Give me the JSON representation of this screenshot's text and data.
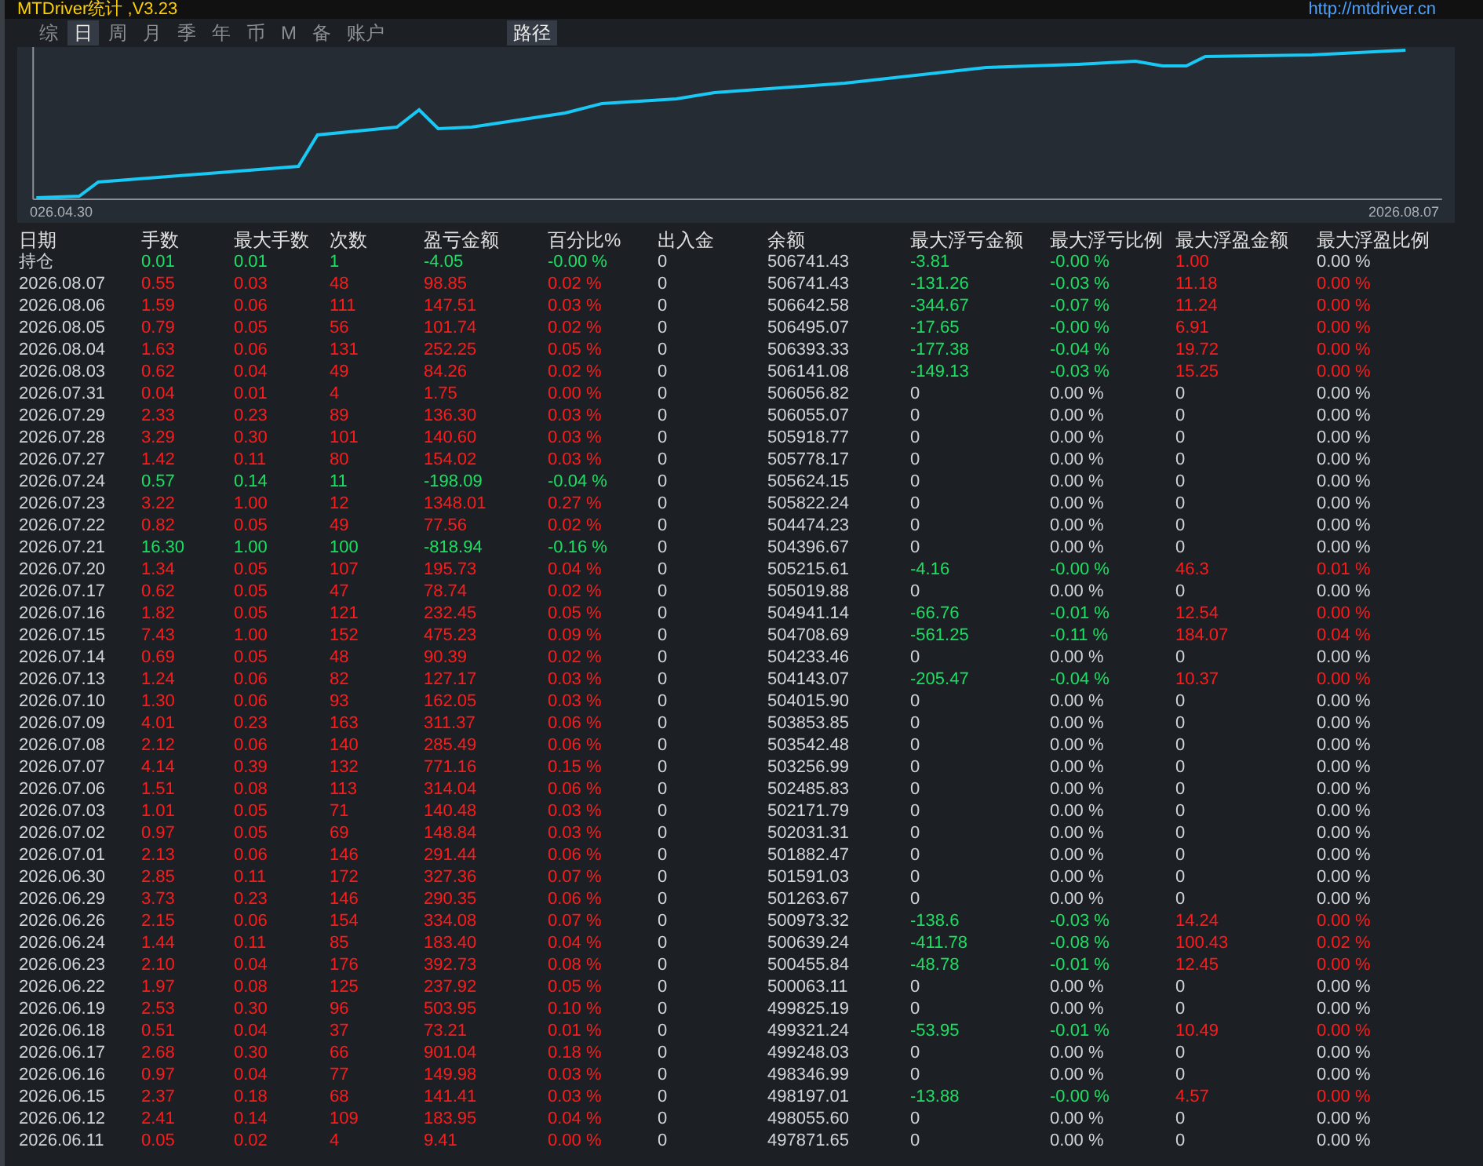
{
  "title_bar": {
    "title": "MTDriver统计 ,V3.23",
    "url": "http://mtdriver.cn"
  },
  "tabs": [
    {
      "label": "综",
      "selected": false
    },
    {
      "label": "日",
      "selected": true
    },
    {
      "label": "周",
      "selected": false
    },
    {
      "label": "月",
      "selected": false
    },
    {
      "label": "季",
      "selected": false
    },
    {
      "label": "年",
      "selected": false
    },
    {
      "label": "币",
      "selected": false
    },
    {
      "label": "M",
      "selected": false
    },
    {
      "label": "备",
      "selected": false
    },
    {
      "label": "账户",
      "selected": false
    }
  ],
  "path_button": {
    "label": "路径"
  },
  "chart": {
    "start_label": "026.04.30",
    "end_label": "2026.08.07"
  },
  "table": {
    "columns": [
      "日期",
      "手数",
      "最大手数",
      "次数",
      "盈亏金额",
      "百分比%",
      "出入金",
      "余额",
      "最大浮亏金额",
      "最大浮亏比例",
      "最大浮盈金额",
      "最大浮盈比例"
    ],
    "rows": [
      {
        "kind": "position",
        "loss": true,
        "floating": true,
        "cells": [
          "持仓",
          "0.01",
          "0.01",
          "1",
          "-4.05",
          "-0.00 %",
          "0",
          "506741.43",
          "-3.81",
          "-0.00 %",
          "1.00",
          "0.00 %"
        ]
      },
      {
        "kind": "day",
        "loss": false,
        "floating": true,
        "cells": [
          "2026.08.07",
          "0.55",
          "0.03",
          "48",
          "98.85",
          "0.02 %",
          "0",
          "506741.43",
          "-131.26",
          "-0.03 %",
          "11.18",
          "0.00 %"
        ]
      },
      {
        "kind": "day",
        "loss": false,
        "floating": true,
        "cells": [
          "2026.08.06",
          "1.59",
          "0.06",
          "111",
          "147.51",
          "0.03 %",
          "0",
          "506642.58",
          "-344.67",
          "-0.07 %",
          "11.24",
          "0.00 %"
        ]
      },
      {
        "kind": "day",
        "loss": false,
        "floating": true,
        "cells": [
          "2026.08.05",
          "0.79",
          "0.05",
          "56",
          "101.74",
          "0.02 %",
          "0",
          "506495.07",
          "-17.65",
          "-0.00 %",
          "6.91",
          "0.00 %"
        ]
      },
      {
        "kind": "day",
        "loss": false,
        "floating": true,
        "cells": [
          "2026.08.04",
          "1.63",
          "0.06",
          "131",
          "252.25",
          "0.05 %",
          "0",
          "506393.33",
          "-177.38",
          "-0.04 %",
          "19.72",
          "0.00 %"
        ]
      },
      {
        "kind": "day",
        "loss": false,
        "floating": true,
        "cells": [
          "2026.08.03",
          "0.62",
          "0.04",
          "49",
          "84.26",
          "0.02 %",
          "0",
          "506141.08",
          "-149.13",
          "-0.03 %",
          "15.25",
          "0.00 %"
        ]
      },
      {
        "kind": "day",
        "loss": false,
        "floating": false,
        "cells": [
          "2026.07.31",
          "0.04",
          "0.01",
          "4",
          "1.75",
          "0.00 %",
          "0",
          "506056.82",
          "0",
          "0.00 %",
          "0",
          "0.00 %"
        ]
      },
      {
        "kind": "day",
        "loss": false,
        "floating": false,
        "cells": [
          "2026.07.29",
          "2.33",
          "0.23",
          "89",
          "136.30",
          "0.03 %",
          "0",
          "506055.07",
          "0",
          "0.00 %",
          "0",
          "0.00 %"
        ]
      },
      {
        "kind": "day",
        "loss": false,
        "floating": false,
        "cells": [
          "2026.07.28",
          "3.29",
          "0.30",
          "101",
          "140.60",
          "0.03 %",
          "0",
          "505918.77",
          "0",
          "0.00 %",
          "0",
          "0.00 %"
        ]
      },
      {
        "kind": "day",
        "loss": false,
        "floating": false,
        "cells": [
          "2026.07.27",
          "1.42",
          "0.11",
          "80",
          "154.02",
          "0.03 %",
          "0",
          "505778.17",
          "0",
          "0.00 %",
          "0",
          "0.00 %"
        ]
      },
      {
        "kind": "day",
        "loss": true,
        "floating": false,
        "cells": [
          "2026.07.24",
          "0.57",
          "0.14",
          "11",
          "-198.09",
          "-0.04 %",
          "0",
          "505624.15",
          "0",
          "0.00 %",
          "0",
          "0.00 %"
        ]
      },
      {
        "kind": "day",
        "loss": false,
        "floating": false,
        "cells": [
          "2026.07.23",
          "3.22",
          "1.00",
          "12",
          "1348.01",
          "0.27 %",
          "0",
          "505822.24",
          "0",
          "0.00 %",
          "0",
          "0.00 %"
        ]
      },
      {
        "kind": "day",
        "loss": false,
        "floating": false,
        "cells": [
          "2026.07.22",
          "0.82",
          "0.05",
          "49",
          "77.56",
          "0.02 %",
          "0",
          "504474.23",
          "0",
          "0.00 %",
          "0",
          "0.00 %"
        ]
      },
      {
        "kind": "day",
        "loss": true,
        "floating": false,
        "cells": [
          "2026.07.21",
          "16.30",
          "1.00",
          "100",
          "-818.94",
          "-0.16 %",
          "0",
          "504396.67",
          "0",
          "0.00 %",
          "0",
          "0.00 %"
        ]
      },
      {
        "kind": "day",
        "loss": false,
        "floating": true,
        "cells": [
          "2026.07.20",
          "1.34",
          "0.05",
          "107",
          "195.73",
          "0.04 %",
          "0",
          "505215.61",
          "-4.16",
          "-0.00 %",
          "46.3",
          "0.01 %"
        ]
      },
      {
        "kind": "day",
        "loss": false,
        "floating": false,
        "cells": [
          "2026.07.17",
          "0.62",
          "0.05",
          "47",
          "78.74",
          "0.02 %",
          "0",
          "505019.88",
          "0",
          "0.00 %",
          "0",
          "0.00 %"
        ]
      },
      {
        "kind": "day",
        "loss": false,
        "floating": true,
        "cells": [
          "2026.07.16",
          "1.82",
          "0.05",
          "121",
          "232.45",
          "0.05 %",
          "0",
          "504941.14",
          "-66.76",
          "-0.01 %",
          "12.54",
          "0.00 %"
        ]
      },
      {
        "kind": "day",
        "loss": false,
        "floating": true,
        "cells": [
          "2026.07.15",
          "7.43",
          "1.00",
          "152",
          "475.23",
          "0.09 %",
          "0",
          "504708.69",
          "-561.25",
          "-0.11 %",
          "184.07",
          "0.04 %"
        ]
      },
      {
        "kind": "day",
        "loss": false,
        "floating": false,
        "cells": [
          "2026.07.14",
          "0.69",
          "0.05",
          "48",
          "90.39",
          "0.02 %",
          "0",
          "504233.46",
          "0",
          "0.00 %",
          "0",
          "0.00 %"
        ]
      },
      {
        "kind": "day",
        "loss": false,
        "floating": true,
        "cells": [
          "2026.07.13",
          "1.24",
          "0.06",
          "82",
          "127.17",
          "0.03 %",
          "0",
          "504143.07",
          "-205.47",
          "-0.04 %",
          "10.37",
          "0.00 %"
        ]
      },
      {
        "kind": "day",
        "loss": false,
        "floating": false,
        "cells": [
          "2026.07.10",
          "1.30",
          "0.06",
          "93",
          "162.05",
          "0.03 %",
          "0",
          "504015.90",
          "0",
          "0.00 %",
          "0",
          "0.00 %"
        ]
      },
      {
        "kind": "day",
        "loss": false,
        "floating": false,
        "cells": [
          "2026.07.09",
          "4.01",
          "0.23",
          "163",
          "311.37",
          "0.06 %",
          "0",
          "503853.85",
          "0",
          "0.00 %",
          "0",
          "0.00 %"
        ]
      },
      {
        "kind": "day",
        "loss": false,
        "floating": false,
        "cells": [
          "2026.07.08",
          "2.12",
          "0.06",
          "140",
          "285.49",
          "0.06 %",
          "0",
          "503542.48",
          "0",
          "0.00 %",
          "0",
          "0.00 %"
        ]
      },
      {
        "kind": "day",
        "loss": false,
        "floating": false,
        "cells": [
          "2026.07.07",
          "4.14",
          "0.39",
          "132",
          "771.16",
          "0.15 %",
          "0",
          "503256.99",
          "0",
          "0.00 %",
          "0",
          "0.00 %"
        ]
      },
      {
        "kind": "day",
        "loss": false,
        "floating": false,
        "cells": [
          "2026.07.06",
          "1.51",
          "0.08",
          "113",
          "314.04",
          "0.06 %",
          "0",
          "502485.83",
          "0",
          "0.00 %",
          "0",
          "0.00 %"
        ]
      },
      {
        "kind": "day",
        "loss": false,
        "floating": false,
        "cells": [
          "2026.07.03",
          "1.01",
          "0.05",
          "71",
          "140.48",
          "0.03 %",
          "0",
          "502171.79",
          "0",
          "0.00 %",
          "0",
          "0.00 %"
        ]
      },
      {
        "kind": "day",
        "loss": false,
        "floating": false,
        "cells": [
          "2026.07.02",
          "0.97",
          "0.05",
          "69",
          "148.84",
          "0.03 %",
          "0",
          "502031.31",
          "0",
          "0.00 %",
          "0",
          "0.00 %"
        ]
      },
      {
        "kind": "day",
        "loss": false,
        "floating": false,
        "cells": [
          "2026.07.01",
          "2.13",
          "0.06",
          "146",
          "291.44",
          "0.06 %",
          "0",
          "501882.47",
          "0",
          "0.00 %",
          "0",
          "0.00 %"
        ]
      },
      {
        "kind": "day",
        "loss": false,
        "floating": false,
        "cells": [
          "2026.06.30",
          "2.85",
          "0.11",
          "172",
          "327.36",
          "0.07 %",
          "0",
          "501591.03",
          "0",
          "0.00 %",
          "0",
          "0.00 %"
        ]
      },
      {
        "kind": "day",
        "loss": false,
        "floating": false,
        "cells": [
          "2026.06.29",
          "3.73",
          "0.23",
          "146",
          "290.35",
          "0.06 %",
          "0",
          "501263.67",
          "0",
          "0.00 %",
          "0",
          "0.00 %"
        ]
      },
      {
        "kind": "day",
        "loss": false,
        "floating": true,
        "cells": [
          "2026.06.26",
          "2.15",
          "0.06",
          "154",
          "334.08",
          "0.07 %",
          "0",
          "500973.32",
          "-138.6",
          "-0.03 %",
          "14.24",
          "0.00 %"
        ]
      },
      {
        "kind": "day",
        "loss": false,
        "floating": true,
        "cells": [
          "2026.06.24",
          "1.44",
          "0.11",
          "85",
          "183.40",
          "0.04 %",
          "0",
          "500639.24",
          "-411.78",
          "-0.08 %",
          "100.43",
          "0.02 %"
        ]
      },
      {
        "kind": "day",
        "loss": false,
        "floating": true,
        "cells": [
          "2026.06.23",
          "2.10",
          "0.04",
          "176",
          "392.73",
          "0.08 %",
          "0",
          "500455.84",
          "-48.78",
          "-0.01 %",
          "12.45",
          "0.00 %"
        ]
      },
      {
        "kind": "day",
        "loss": false,
        "floating": false,
        "cells": [
          "2026.06.22",
          "1.97",
          "0.08",
          "125",
          "237.92",
          "0.05 %",
          "0",
          "500063.11",
          "0",
          "0.00 %",
          "0",
          "0.00 %"
        ]
      },
      {
        "kind": "day",
        "loss": false,
        "floating": false,
        "cells": [
          "2026.06.19",
          "2.53",
          "0.30",
          "96",
          "503.95",
          "0.10 %",
          "0",
          "499825.19",
          "0",
          "0.00 %",
          "0",
          "0.00 %"
        ]
      },
      {
        "kind": "day",
        "loss": false,
        "floating": true,
        "cells": [
          "2026.06.18",
          "0.51",
          "0.04",
          "37",
          "73.21",
          "0.01 %",
          "0",
          "499321.24",
          "-53.95",
          "-0.01 %",
          "10.49",
          "0.00 %"
        ]
      },
      {
        "kind": "day",
        "loss": false,
        "floating": false,
        "cells": [
          "2026.06.17",
          "2.68",
          "0.30",
          "66",
          "901.04",
          "0.18 %",
          "0",
          "499248.03",
          "0",
          "0.00 %",
          "0",
          "0.00 %"
        ]
      },
      {
        "kind": "day",
        "loss": false,
        "floating": false,
        "cells": [
          "2026.06.16",
          "0.97",
          "0.04",
          "77",
          "149.98",
          "0.03 %",
          "0",
          "498346.99",
          "0",
          "0.00 %",
          "0",
          "0.00 %"
        ]
      },
      {
        "kind": "day",
        "loss": false,
        "floating": true,
        "cells": [
          "2026.06.15",
          "2.37",
          "0.18",
          "68",
          "141.41",
          "0.03 %",
          "0",
          "498197.01",
          "-13.88",
          "-0.00 %",
          "4.57",
          "0.00 %"
        ]
      },
      {
        "kind": "day",
        "loss": false,
        "floating": false,
        "cells": [
          "2026.06.12",
          "2.41",
          "0.14",
          "109",
          "183.95",
          "0.04 %",
          "0",
          "498055.60",
          "0",
          "0.00 %",
          "0",
          "0.00 %"
        ]
      },
      {
        "kind": "day",
        "loss": false,
        "floating": false,
        "cells": [
          "2026.06.11",
          "0.05",
          "0.02",
          "4",
          "9.41",
          "0.00 %",
          "0",
          "497871.65",
          "0",
          "0.00 %",
          "0",
          "0.00 %"
        ]
      }
    ]
  }
}
